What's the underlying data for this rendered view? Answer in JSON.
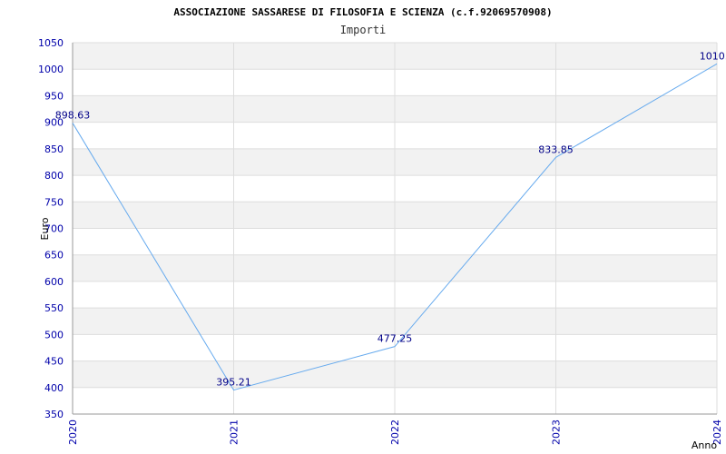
{
  "chart_data": {
    "type": "line",
    "title": "ASSOCIAZIONE SASSARESE DI FILOSOFIA E SCIENZA (c.f.92069570908)",
    "subtitle": "Importi",
    "xlabel": "Anno",
    "ylabel": "Euro",
    "categories": [
      "2020",
      "2021",
      "2022",
      "2023",
      "2024"
    ],
    "series": [
      {
        "values": [
          898.63,
          395.21,
          477.25,
          833.85,
          1010.1
        ]
      }
    ],
    "data_labels": [
      "898.63",
      "395.21",
      "477.25",
      "833.85",
      "1010.1"
    ],
    "ylim": [
      350,
      1050
    ],
    "yticks": [
      350,
      400,
      450,
      500,
      550,
      600,
      650,
      700,
      750,
      800,
      850,
      900,
      950,
      1000,
      1050
    ],
    "grid": true,
    "legend": "none",
    "colors": {
      "line": "#66aaee",
      "tick_text": "#0000aa",
      "label_text": "#000088",
      "band": "#f2f2f2",
      "gridline": "#dddddd"
    }
  }
}
